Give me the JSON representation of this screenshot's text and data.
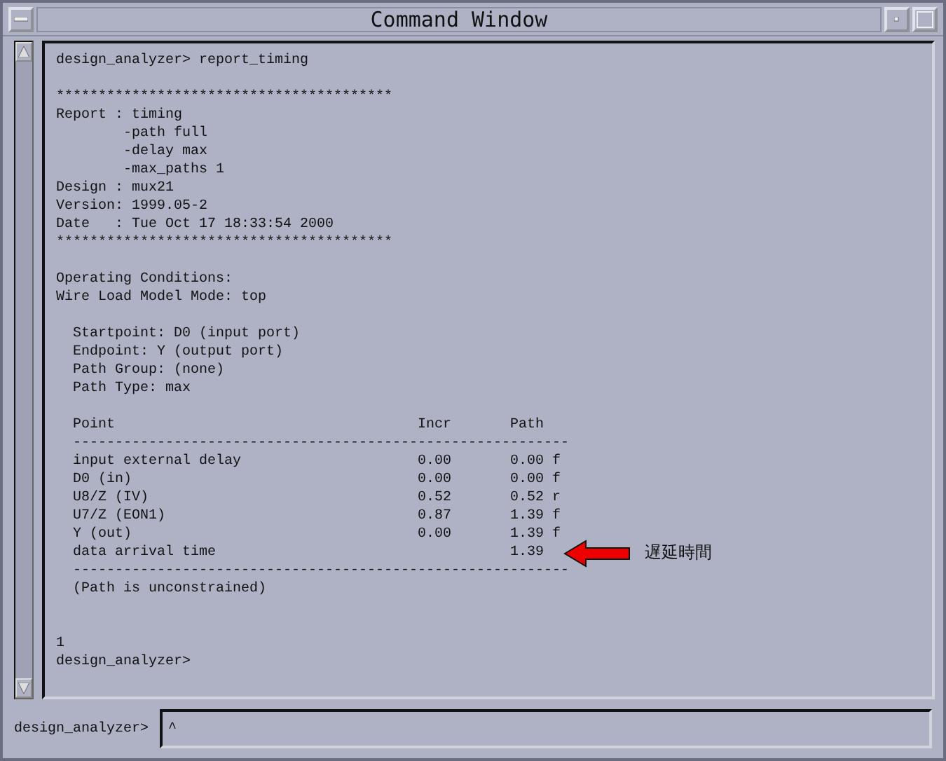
{
  "window": {
    "title": "Command Window"
  },
  "output_lines": [
    {
      "kind": "text",
      "text": "design_analyzer> report_timing"
    },
    {
      "kind": "blank"
    },
    {
      "kind": "text",
      "text": "****************************************"
    },
    {
      "kind": "text",
      "text": "Report : timing"
    },
    {
      "kind": "text",
      "text": "        -path full"
    },
    {
      "kind": "text",
      "text": "        -delay max"
    },
    {
      "kind": "text",
      "text": "        -max_paths 1"
    },
    {
      "kind": "text",
      "text": "Design : mux21"
    },
    {
      "kind": "text",
      "text": "Version: 1999.05-2"
    },
    {
      "kind": "text",
      "text": "Date   : Tue Oct 17 18:33:54 2000"
    },
    {
      "kind": "text",
      "text": "****************************************"
    },
    {
      "kind": "blank"
    },
    {
      "kind": "text",
      "text": "Operating Conditions:"
    },
    {
      "kind": "text",
      "text": "Wire Load Model Mode: top"
    },
    {
      "kind": "blank"
    },
    {
      "kind": "text",
      "text": "  Startpoint: D0 (input port)"
    },
    {
      "kind": "text",
      "text": "  Endpoint: Y (output port)"
    },
    {
      "kind": "text",
      "text": "  Path Group: (none)"
    },
    {
      "kind": "text",
      "text": "  Path Type: max"
    },
    {
      "kind": "blank"
    },
    {
      "kind": "text",
      "text": "  Point                                    Incr       Path"
    },
    {
      "kind": "text",
      "text": "  -----------------------------------------------------------"
    },
    {
      "kind": "text",
      "text": "  input external delay                     0.00       0.00 f"
    },
    {
      "kind": "text",
      "text": "  D0 (in)                                  0.00       0.00 f"
    },
    {
      "kind": "text",
      "text": "  U8/Z (IV)                                0.52       0.52 r"
    },
    {
      "kind": "text",
      "text": "  U7/Z (EON1)                              0.87       1.39 f"
    },
    {
      "kind": "text",
      "text": "  Y (out)                                  0.00       1.39 f"
    },
    {
      "kind": "text",
      "text": "  data arrival time                                   1.39",
      "annotation": "遅延時間"
    },
    {
      "kind": "text",
      "text": "  -----------------------------------------------------------"
    },
    {
      "kind": "text",
      "text": "  (Path is unconstrained)"
    },
    {
      "kind": "blank"
    },
    {
      "kind": "blank"
    },
    {
      "kind": "text",
      "text": "1"
    },
    {
      "kind": "text",
      "text": "design_analyzer>"
    }
  ],
  "command_input": {
    "label": "design_analyzer>",
    "cursor": "^"
  }
}
